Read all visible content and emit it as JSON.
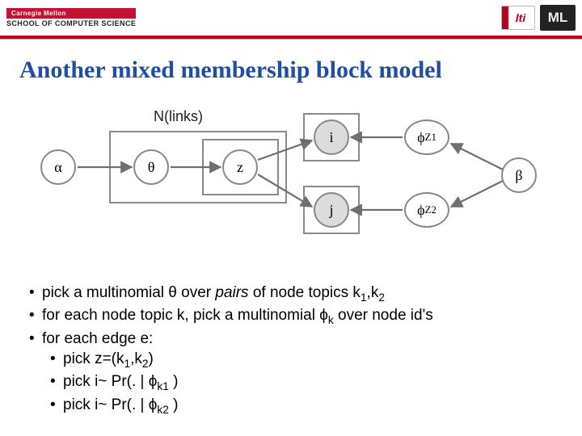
{
  "header": {
    "cmu_tag": "Carnegie Mellon",
    "scs_tag": "SCHOOL OF COMPUTER SCIENCE",
    "lti": "lti",
    "ml": "ML"
  },
  "title": "Another mixed membership block model",
  "diagram": {
    "plate_label": "N(links)",
    "nodes": {
      "alpha": "α",
      "theta": "θ",
      "z": "z",
      "i": "i",
      "j": "j",
      "phi_z1": "ϕ",
      "phi_z1_sub": "Z1",
      "phi_z2": "ϕ",
      "phi_z2_sub": "Z2",
      "beta": "β"
    }
  },
  "bullets": {
    "b1_pre": "pick a multinomial θ over ",
    "b1_ital": "pairs",
    "b1_post": " of node topics k",
    "b1_k1": "1",
    "b1_mid": ",k",
    "b1_k2": "2",
    "b2_pre": "for each node topic k, pick a multinomial ϕ",
    "b2_sub": "k",
    "b2_post": " over node id's",
    "b3": "for each edge e:",
    "b4_pre": "pick z=(k",
    "b4_k1": "1",
    "b4_mid": ",k",
    "b4_k2": "2",
    "b4_post": ")",
    "b5_pre": "pick i~ Pr(. | ϕ",
    "b5_sub": "k1",
    "b5_post": " )",
    "b6_pre": "pick i~ Pr(. | ϕ",
    "b6_sub": "k2",
    "b6_post": " )"
  }
}
